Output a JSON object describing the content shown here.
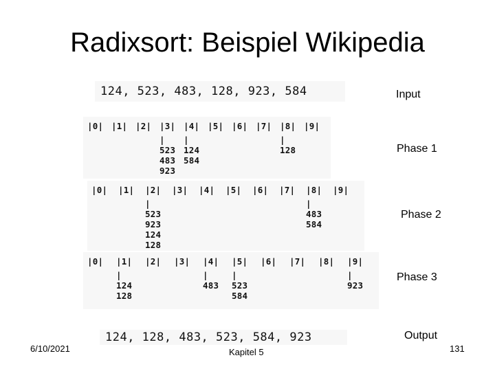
{
  "slide": {
    "title": "Radixsort: Beispiel Wikipedia",
    "footer": {
      "date": "6/10/2021",
      "chapter": "Kapitel 5",
      "page": "131"
    }
  },
  "input": {
    "label": "Input",
    "sequence": "124, 523, 483, 128, 923, 584"
  },
  "phases": [
    {
      "label": "Phase 1",
      "buckets": [
        "|0|",
        "|1|",
        "|2|",
        "|3|",
        "|4|",
        "|5|",
        "|6|",
        "|7|",
        "|8|",
        "|9|"
      ],
      "contents": [
        {
          "bucket": 3,
          "text": "|\n523\n483\n923"
        },
        {
          "bucket": 4,
          "text": "|\n124\n584"
        },
        {
          "bucket": 8,
          "text": "|\n128"
        }
      ]
    },
    {
      "label": "Phase 2",
      "buckets": [
        "|0|",
        "|1|",
        "|2|",
        "|3|",
        "|4|",
        "|5|",
        "|6|",
        "|7|",
        "|8|",
        "|9|"
      ],
      "contents": [
        {
          "bucket": 2,
          "text": "|\n523\n923\n124\n128"
        },
        {
          "bucket": 8,
          "text": "|\n483\n584"
        }
      ]
    },
    {
      "label": "Phase 3",
      "buckets": [
        "|0|",
        "|1|",
        "|2|",
        "|3|",
        "|4|",
        "|5|",
        "|6|",
        "|7|",
        "|8|",
        "|9|"
      ],
      "contents": [
        {
          "bucket": 1,
          "text": "|\n124\n128"
        },
        {
          "bucket": 4,
          "text": "|\n483"
        },
        {
          "bucket": 5,
          "text": "|\n523\n584"
        },
        {
          "bucket": 9,
          "text": "|\n923"
        }
      ]
    }
  ],
  "output": {
    "label": "Output",
    "sequence": "124, 128, 483, 523, 584, 923"
  }
}
